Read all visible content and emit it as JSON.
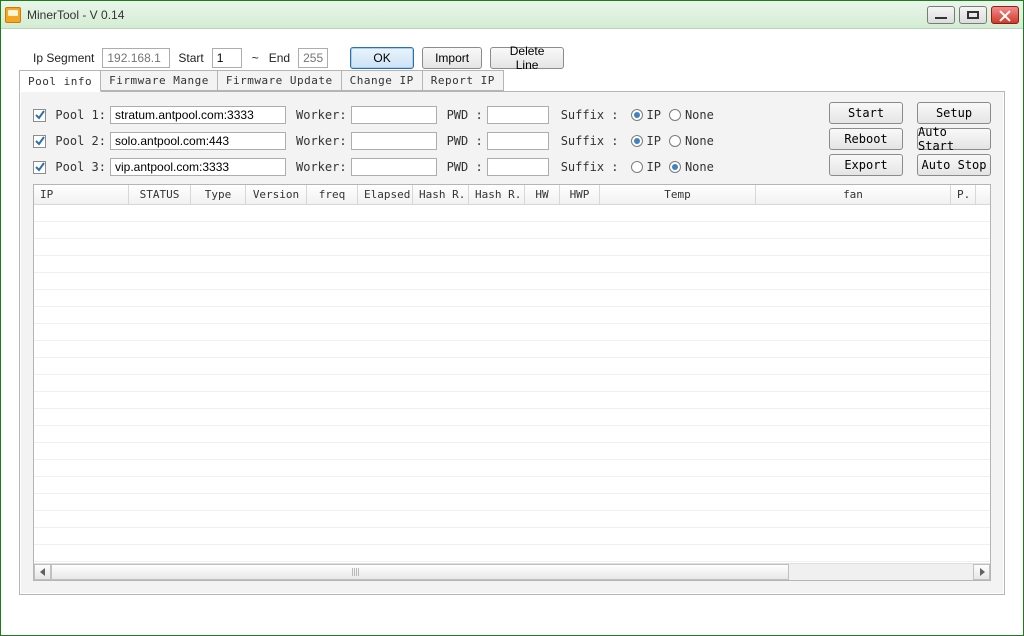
{
  "window": {
    "title": "MinerTool - V 0.14"
  },
  "toprow": {
    "ip_segment_label": "Ip Segment",
    "ip_segment_placeholder": "192.168.1",
    "start_label": "Start",
    "start_value": "1",
    "tilde": "~",
    "end_label": "End",
    "end_placeholder": "255",
    "ok": "OK",
    "import": "Import",
    "delete_line": "Delete Line"
  },
  "tabs": {
    "pool_info": "Pool info",
    "firmware_mange": "Firmware Mange",
    "firmware_update": "Firmware Update",
    "change_ip": "Change IP",
    "report_ip": "Report IP"
  },
  "pools": {
    "worker_label": "Worker:",
    "pwd_label": "PWD :",
    "suffix_label": "Suffix :",
    "ip_option": "IP",
    "none_option": "None",
    "rows": {
      "0": {
        "label": "Pool 1:",
        "url": "stratum.antpool.com:3333",
        "suffix_sel": "ip"
      },
      "1": {
        "label": "Pool 2:",
        "url": "solo.antpool.com:443",
        "suffix_sel": "ip"
      },
      "2": {
        "label": "Pool 3:",
        "url": "vip.antpool.com:3333",
        "suffix_sel": "none"
      }
    }
  },
  "buttons": {
    "start": "Start",
    "setup": "Setup",
    "reboot": "Reboot",
    "auto_start": "Auto Start",
    "export": "Export",
    "auto_stop": "Auto Stop"
  },
  "columns": {
    "ip": "IP",
    "status": "STATUS",
    "type": "Type",
    "version": "Version",
    "freq": "freq",
    "elapsed": "Elapsed",
    "hash_r1": "Hash R...",
    "hash_r2": "Hash R...",
    "hw": "HW",
    "hwp": "HWP",
    "temp": "Temp",
    "fan": "fan",
    "p": "P."
  },
  "col_widths": {
    "ip": 95,
    "status": 62,
    "type": 55,
    "version": 61,
    "freq": 51,
    "elapsed": 55,
    "hash_r1": 56,
    "hash_r2": 56,
    "hw": 35,
    "hwp": 40,
    "temp": 156,
    "fan": 195,
    "p": 25
  }
}
